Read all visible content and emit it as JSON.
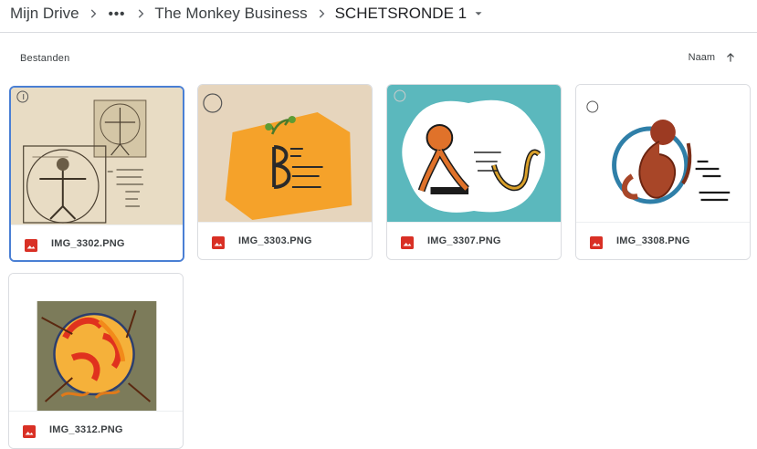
{
  "breadcrumb": {
    "root": "Mijn Drive",
    "overflow": "•••",
    "folder": "The Monkey Business",
    "current": "SCHETSRONDE 1"
  },
  "section": {
    "label": "Bestanden"
  },
  "sort": {
    "label": "Naam",
    "icon": "arrow-up-icon"
  },
  "files": [
    {
      "name": "IMG_3302.PNG",
      "selected": true
    },
    {
      "name": "IMG_3303.PNG",
      "selected": false
    },
    {
      "name": "IMG_3307.PNG",
      "selected": false
    },
    {
      "name": "IMG_3308.PNG",
      "selected": false
    },
    {
      "name": "IMG_3312.PNG",
      "selected": false
    }
  ],
  "file_icon": {
    "name": "image-file-icon",
    "color": "#d93025"
  },
  "accent": "#4a7fd4"
}
